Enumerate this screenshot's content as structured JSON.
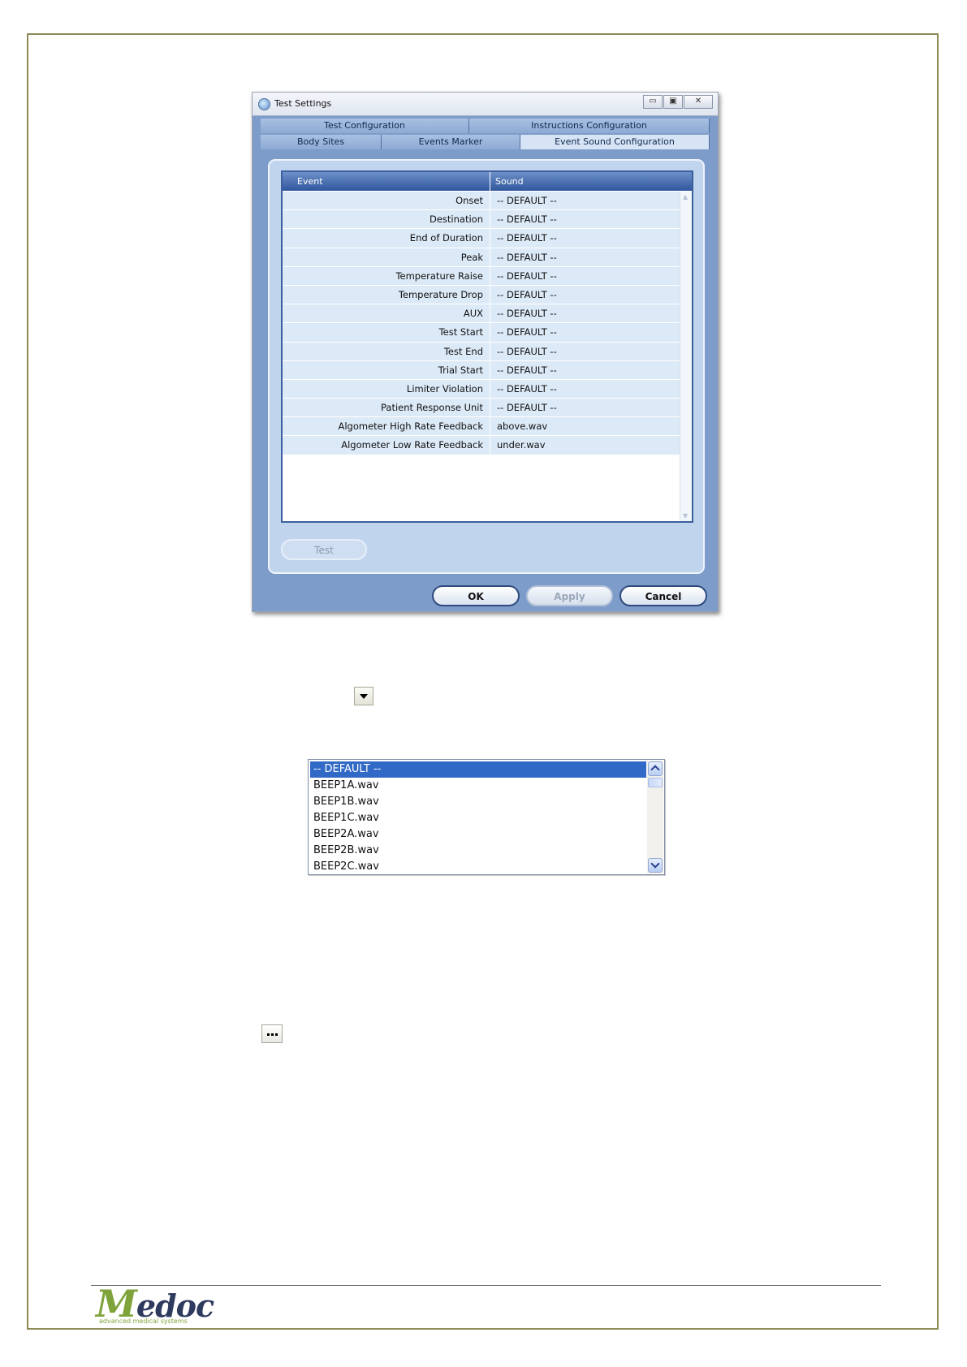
{
  "window": {
    "title": "Test Settings",
    "controls": {
      "minimize": "▭",
      "maximize": "▣",
      "close": "✕"
    }
  },
  "tabs": {
    "row1": [
      "Test Configuration",
      "Instructions Configuration"
    ],
    "row2": [
      "Body Sites",
      "Events Marker",
      "Event Sound Configuration"
    ],
    "active": "Event Sound Configuration"
  },
  "grid": {
    "columns": {
      "event": "Event",
      "sound": "Sound"
    },
    "rows": [
      {
        "event": "Onset",
        "sound": "-- DEFAULT --"
      },
      {
        "event": "Destination",
        "sound": "-- DEFAULT --"
      },
      {
        "event": "End of Duration",
        "sound": "-- DEFAULT --"
      },
      {
        "event": "Peak",
        "sound": "-- DEFAULT --"
      },
      {
        "event": "Temperature Raise",
        "sound": "-- DEFAULT --"
      },
      {
        "event": "Temperature Drop",
        "sound": "-- DEFAULT --"
      },
      {
        "event": "AUX",
        "sound": "-- DEFAULT --"
      },
      {
        "event": "Test Start",
        "sound": "-- DEFAULT --"
      },
      {
        "event": "Test End",
        "sound": "-- DEFAULT --"
      },
      {
        "event": "Trial Start",
        "sound": "-- DEFAULT --"
      },
      {
        "event": "Limiter Violation",
        "sound": "-- DEFAULT --"
      },
      {
        "event": "Patient Response Unit",
        "sound": "-- DEFAULT --"
      },
      {
        "event": "Algometer High Rate Feedback",
        "sound": "above.wav"
      },
      {
        "event": "Algometer Low Rate Feedback",
        "sound": "under.wav"
      }
    ]
  },
  "buttons": {
    "test": "Test",
    "ok": "OK",
    "apply": "Apply",
    "cancel": "Cancel"
  },
  "sound_list": {
    "items": [
      "-- DEFAULT --",
      "BEEP1A.wav",
      "BEEP1B.wav",
      "BEEP1C.wav",
      "BEEP2A.wav",
      "BEEP2B.wav",
      "BEEP2C.wav"
    ],
    "selected": "-- DEFAULT --"
  },
  "icons": {
    "dropdown": "dropdown-arrow-icon",
    "browse": "ellipsis-icon"
  },
  "footer": {
    "logo_text": "edoc",
    "logo_initial": "M",
    "logo_subtitle": "advanced medical systems"
  },
  "colors": {
    "selection": "#3169c6",
    "header": "#2f569c",
    "border": "#8c8a56",
    "logo_green": "#7ea33a"
  }
}
